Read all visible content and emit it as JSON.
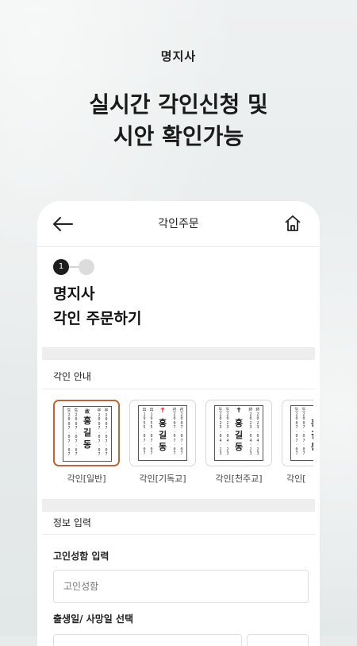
{
  "promo": {
    "app_label": "명지사",
    "headline_line1": "실시간 각인신청 및",
    "headline_line2": "시안 확인가능"
  },
  "topbar": {
    "title": "각인주문",
    "back_icon": "arrow-left-icon",
    "home_icon": "home-icon"
  },
  "steps": {
    "current": "1",
    "total_visible": 2
  },
  "page": {
    "title_line1": "명지사",
    "title_line2": "각인 주문하기"
  },
  "engraving_guide": {
    "section_label": "각인 안내",
    "cards": [
      {
        "caption": "각인[일반]",
        "selected": true,
        "symbol": "故",
        "name": [
          "홍",
          "길",
          "동"
        ]
      },
      {
        "caption": "각인[기독교]",
        "selected": false,
        "symbol": "✝",
        "name": [
          "홍",
          "길",
          "동"
        ]
      },
      {
        "caption": "각인[천주교]",
        "selected": false,
        "symbol": "✝",
        "name": [
          "홍",
          "길",
          "동"
        ]
      },
      {
        "caption": "각인[",
        "selected": false,
        "symbol": "",
        "name": [
          "홍",
          "길",
          "동"
        ]
      }
    ],
    "colors": {
      "selected_border": "#b8663a",
      "protestant_cross": "#c62828",
      "catholic_cross": "#1a1a1a"
    }
  },
  "info": {
    "section_label": "정보 입력",
    "name_label": "고인성함 입력",
    "name_placeholder": "고인성함",
    "date_label": "출생일/ 사망일 선택"
  }
}
